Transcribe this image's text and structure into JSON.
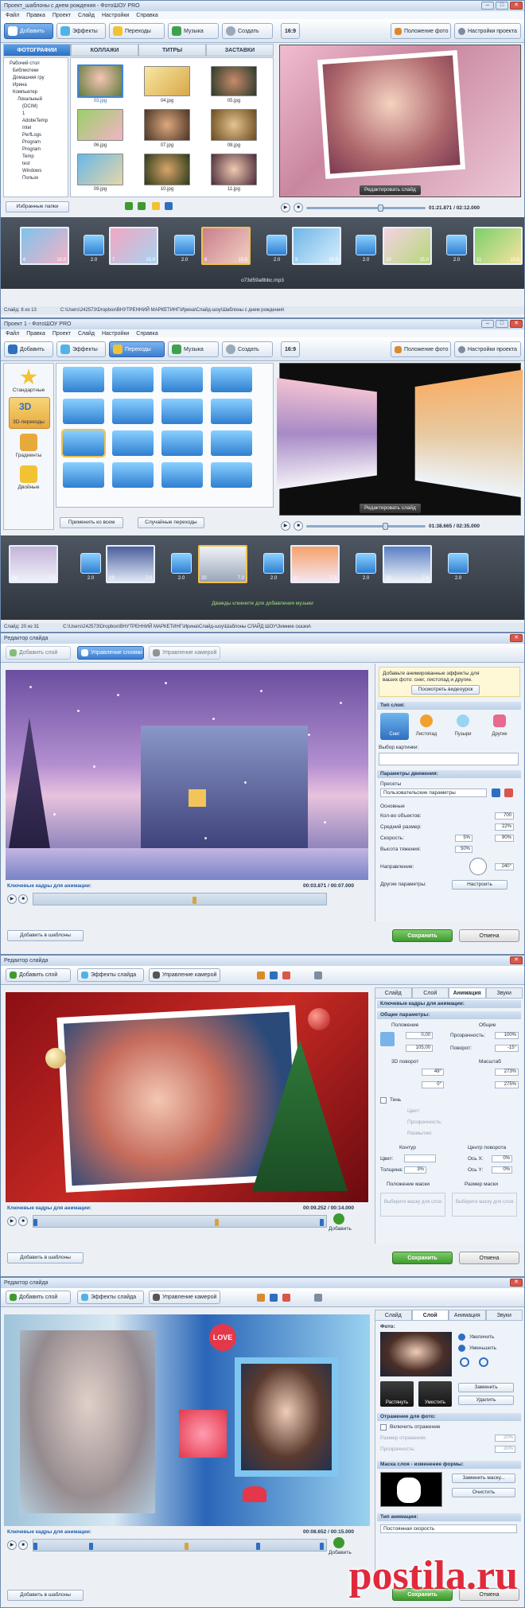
{
  "window1": {
    "title": "Проект_шаблоны с днем рождения - ФотоШОУ PRO",
    "menu": [
      "Файл",
      "Правка",
      "Проект",
      "Слайд",
      "Настройки",
      "Справка"
    ],
    "toolbar": {
      "add": "Добавить",
      "effects": "Эффекты",
      "transitions": "Переходы",
      "music": "Музыка",
      "create": "Создать",
      "aspect": "16:9",
      "photo_pos": "Положение фото",
      "project_settings": "Настройки проекта"
    },
    "tabs": [
      "ФОТОГРАФИИ",
      "КОЛЛАЖИ",
      "ТИТРЫ",
      "ЗАСТАВКИ"
    ],
    "tree": [
      "Рабочий стол",
      "Библиотеки",
      "Домашняя гру",
      "Ирина",
      "Компьютер",
      "Локальный",
      "(DCIM)",
      "1",
      "AdobeTemp",
      "Intel",
      "PerfLogs",
      "Program",
      "Program",
      "Temp",
      "test",
      "Windows",
      "Пользо"
    ],
    "photos": [
      "03.jpg",
      "04.jpg",
      "05.jpg",
      "06.jpg",
      "07.jpg",
      "08.jpg",
      "09.jpg",
      "10.jpg",
      "11.jpg"
    ],
    "fav_folders": "Избранные папки",
    "edit_slide": "Редактировать слайд",
    "time": "01:21.871 / 02:12.000",
    "slides": [
      {
        "num": "6",
        "dur": "15.0"
      },
      {
        "num": "7",
        "dur": "15.0"
      },
      {
        "num": "8",
        "dur": "15.0"
      },
      {
        "num": "9",
        "dur": "15.0"
      },
      {
        "num": "10",
        "dur": "15.0"
      },
      {
        "num": "11",
        "dur": "15.0"
      }
    ],
    "trans_dur": "2.0",
    "music": "o73d59a8bbc.mp3",
    "status_left": "Слайд: 8 из 13",
    "status_path": "C:\\Users\\242573\\Dropbox\\ВНУТРЕННИЙ МАРКЕТИНГ\\Ирина\\Слайд-шоу\\Шаблоны с днем рождения\\"
  },
  "window2": {
    "title": "Проект 1 - ФотоШОУ PRO",
    "menu": [
      "Файл",
      "Правка",
      "Проект",
      "Слайд",
      "Настройки",
      "Справка"
    ],
    "toolbar": {
      "add": "Добавить",
      "effects": "Эффекты",
      "transitions": "Переходы",
      "music": "Музыка",
      "create": "Создать",
      "aspect": "16:9",
      "photo_pos": "Положение фото",
      "project_settings": "Настройки проекта"
    },
    "categories": [
      "Стандартные",
      "3D-переходы",
      "Градиенты",
      "Двойные"
    ],
    "apply_all": "Применить ко всем",
    "random": "Случайные переходы",
    "edit_slide": "Редактировать слайд",
    "time": "01:38.665 / 02:35.000",
    "slides": [
      {
        "num": "18",
        "dur": "7.0"
      },
      {
        "num": "19",
        "dur": "7.0"
      },
      {
        "num": "20",
        "dur": "7.0"
      },
      {
        "num": "21",
        "dur": "7.0"
      },
      {
        "num": "22",
        "dur": "7.0"
      }
    ],
    "trans_dur": "2.0",
    "music_hint": "Дважды кликните для добавления музыки",
    "status_left": "Слайд: 20 из 31",
    "status_path": "C:\\Users\\242573\\Dropbox\\ВНУТРЕННИЙ МАРКЕТИНГ\\Ирина\\Слайд-шоу\\Шаблоны СЛАЙД ШОУ\\Зимние сказки\\"
  },
  "window3": {
    "title": "Редактор слайда",
    "toolbar": {
      "add_layer": "Добавить слой",
      "manage_layers": "Управление слоями",
      "camera": "Управление камерой"
    },
    "promo": "Добавьте анимированные эффекты для ваших фото: снег, листопад и другие.",
    "promo_btn": "Посмотреть видеоурок",
    "layer_type": "Тип слоя:",
    "types": [
      "Снег",
      "Листопад",
      "Пузыри",
      "Другие"
    ],
    "pick_image": "Выбор картинки:",
    "motion_params": "Параметры движения:",
    "presets": "Пресеты",
    "preset_value": "Пользовательские параметры",
    "basic": "Основные",
    "params": [
      {
        "label": "Кол-во объектов:",
        "value": "700"
      },
      {
        "label": "Средний размер:",
        "value": "22%"
      },
      {
        "label": "Скорость:",
        "value": "5%",
        "value2": "90%"
      },
      {
        "label": "Высота тяжения:",
        "value": "50%"
      }
    ],
    "direction": "Направление:",
    "direction_value": "240°",
    "other": "Другие параметры:",
    "configure": "Настроить",
    "keyframes": "Ключевые кадры для анимации:",
    "time": "00:03.871 / 00:07.000",
    "add_template": "Добавить в шаблоны",
    "save": "Сохранить",
    "cancel": "Отмена"
  },
  "window4": {
    "title": "Редактор слайда",
    "toolbar": {
      "add_layer": "Добавить слой",
      "effects": "Эффекты слайда",
      "camera": "Управление камерой"
    },
    "rtabs": [
      "Слайд",
      "Слой",
      "Анимация",
      "Звуки"
    ],
    "kf_title": "Ключевые кадры для анимации:",
    "general": "Общие параметры:",
    "position": "Положение",
    "common": "Общие",
    "opacity_label": "Прозрачность:",
    "opacity": "100%",
    "rotate_label": "Поворот:",
    "rotate": "-15°",
    "pos_x": "0,00",
    "pos_y": "105,00",
    "rot3d": "3D поворот",
    "scale": "Масштаб",
    "rx": "49°",
    "ry": "0°",
    "sx": "273%",
    "sy": "275%",
    "shadow": "Тень",
    "color": "Цвет:",
    "transparency": "Прозрачность:",
    "blur": "Размытие:",
    "contour": "Контур",
    "center": "Центр поворота",
    "thickness": "Толщина:",
    "thickness_val": "3%",
    "axis_x": "Ось X:",
    "axis_y": "Ось Y:",
    "axis_x_val": "0%",
    "axis_y_val": "0%",
    "mask_pos": "Положение маски",
    "mask_size": "Размер маски",
    "choose_mask": "Выберите маску для слоя",
    "keyframes": "Ключевые кадры для анимации:",
    "time": "00:09.252 / 00:14.000",
    "add_kf": "Добавить",
    "add_template": "Добавить в шаблоны",
    "save": "Сохранить",
    "cancel": "Отмена"
  },
  "window5": {
    "title": "Редактор слайда",
    "toolbar": {
      "add_layer": "Добавить слой",
      "effects": "Эффекты слайда",
      "camera": "Управление камерой"
    },
    "rtabs": [
      "Слайд",
      "Слой",
      "Анимация",
      "Звуки"
    ],
    "photo": "Фото:",
    "zoom_in": "Увеличить",
    "zoom_out": "Уменьшить",
    "stretch": "Растянуть",
    "fit": "Уместить",
    "replace": "Заменить",
    "delete": "Удалить",
    "reflection": "Отражение для фото:",
    "enable_reflection": "Включить отражение",
    "refl_size": "Размер отражения:",
    "refl_opacity": "Прозрачность:",
    "refl_size_val": "20%",
    "refl_opacity_val": "30%",
    "mask": "Маска слоя - изменение формы:",
    "replace_mask": "Заменить маску...",
    "clear": "Очистить",
    "anim_type": "Тип анимации:",
    "anim_value": "Постоянная скорость",
    "keyframes": "Ключевые кадры для анимации:",
    "time": "00:08.652 / 00:15.000",
    "add_kf": "Добавить",
    "add_template": "Добавить в шаблоны",
    "save": "Сохранить",
    "cancel": "Отмена",
    "love": "LOVE"
  },
  "watermark": "Postila.ru"
}
